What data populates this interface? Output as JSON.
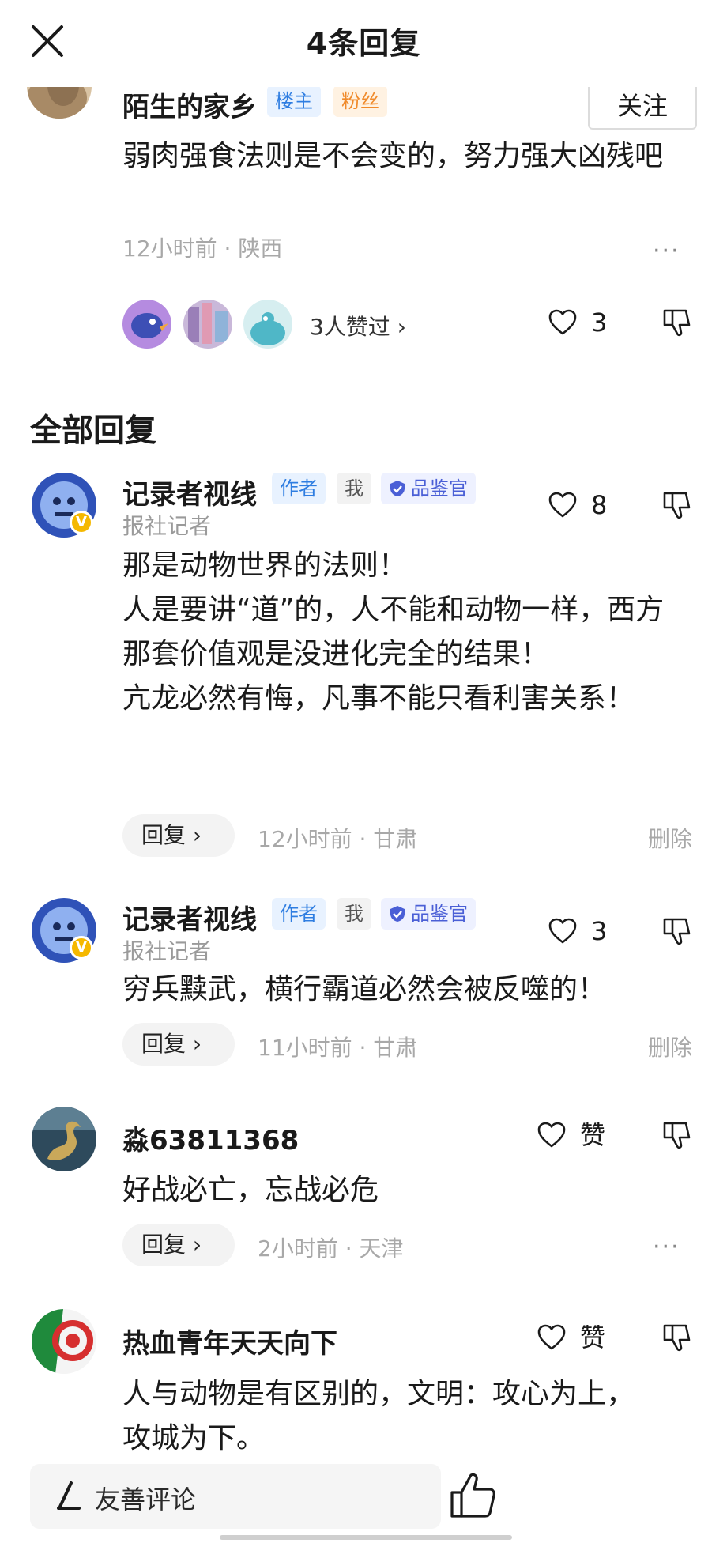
{
  "header": {
    "title": "4条回复"
  },
  "main_comment": {
    "author": "陌生的家乡",
    "tags": [
      "楼主",
      "粉丝"
    ],
    "follow_label": "关注",
    "content": "弱肉强食法则是不会变的，努力强大凶残吧",
    "time": "12小时前",
    "location": "陕西",
    "more": "···",
    "likers_text": "3人赞过 ›",
    "like_count": "3"
  },
  "section_title": "全部回复",
  "replies": [
    {
      "author": "记录者视线",
      "tags": [
        "作者",
        "我",
        "品鉴官"
      ],
      "subtitle": "报社记者",
      "content": "那是动物世界的法则！\n人是要讲“道”的，人不能和动物一样，西方那套价值观是没进化完全的结果！\n亢龙必然有悔，凡事不能只看利害关系！",
      "reply_label": "回复 ›",
      "time": "12小时前",
      "location": "甘肃",
      "like_count": "8",
      "delete_label": "删除"
    },
    {
      "author": "记录者视线",
      "tags": [
        "作者",
        "我",
        "品鉴官"
      ],
      "subtitle": "报社记者",
      "content": "穷兵黩武，横行霸道必然会被反噬的！",
      "reply_label": "回复 ›",
      "time": "11小时前",
      "location": "甘肃",
      "like_count": "3",
      "delete_label": "删除"
    },
    {
      "author": "淼63811368",
      "content": "好战必亡，忘战必危",
      "reply_label": "回复 ›",
      "time": "2小时前",
      "location": "天津",
      "like_count": "赞",
      "more": "···"
    },
    {
      "author": "热血青年天天向下",
      "content": "人与动物是有区别的，文明：攻心为上，攻城为下。",
      "like_count": "赞"
    }
  ],
  "bottom": {
    "placeholder": "友善评论"
  },
  "icons": {
    "close": "close-icon",
    "heart": "heart-icon",
    "dislike": "thumb-down-icon",
    "thumb_up": "thumb-up-icon",
    "pen": "pen-icon",
    "verified": "verified-shield-icon"
  },
  "colors": {
    "tag_blue": "#2e7de1",
    "tag_orange": "#f08a2a",
    "verify_blue": "#4a5fd6",
    "badge_yellow": "#f5b800"
  }
}
